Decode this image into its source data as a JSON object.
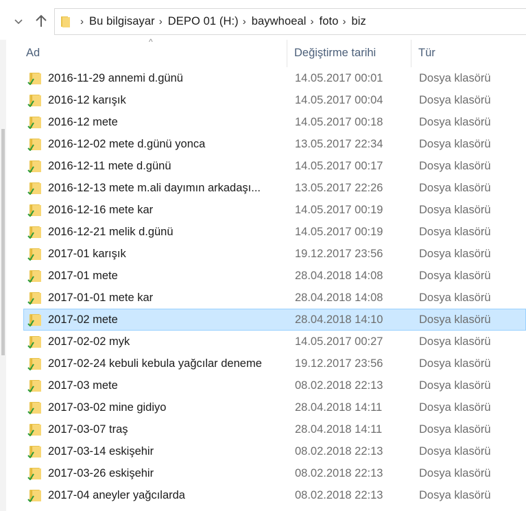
{
  "address": {
    "breadcrumbs": [
      "Bu bilgisayar",
      "DEPO 01 (H:)",
      "baywhoeal",
      "foto",
      "biz"
    ]
  },
  "icons": {
    "recent": "chevron-down-icon",
    "up": "up-arrow-icon",
    "folder": "folder-icon",
    "sync": "green-check-icon"
  },
  "columns": {
    "name": "Ad",
    "date": "Değiştirme tarihi",
    "type": "Tür"
  },
  "rows": [
    {
      "name": "2016-11-29 annemi d.günü",
      "date": "14.05.2017 00:01",
      "type": "Dosya klasörü"
    },
    {
      "name": "2016-12 karışık",
      "date": "14.05.2017 00:04",
      "type": "Dosya klasörü"
    },
    {
      "name": "2016-12 mete",
      "date": "14.05.2017 00:18",
      "type": "Dosya klasörü"
    },
    {
      "name": "2016-12-02 mete d.günü yonca",
      "date": "13.05.2017 22:34",
      "type": "Dosya klasörü"
    },
    {
      "name": "2016-12-11 mete d.günü",
      "date": "14.05.2017 00:17",
      "type": "Dosya klasörü"
    },
    {
      "name": "2016-12-13 mete m.ali dayımın arkadaşı...",
      "date": "13.05.2017 22:26",
      "type": "Dosya klasörü"
    },
    {
      "name": "2016-12-16 mete kar",
      "date": "14.05.2017 00:19",
      "type": "Dosya klasörü"
    },
    {
      "name": "2016-12-21 melik d.günü",
      "date": "14.05.2017 00:19",
      "type": "Dosya klasörü"
    },
    {
      "name": "2017-01 karışık",
      "date": "19.12.2017 23:56",
      "type": "Dosya klasörü"
    },
    {
      "name": "2017-01 mete",
      "date": "28.04.2018 14:08",
      "type": "Dosya klasörü"
    },
    {
      "name": "2017-01-01 mete kar",
      "date": "28.04.2018 14:08",
      "type": "Dosya klasörü"
    },
    {
      "name": "2017-02 mete",
      "date": "28.04.2018 14:10",
      "type": "Dosya klasörü",
      "selected": true
    },
    {
      "name": "2017-02-02 myk",
      "date": "14.05.2017 00:27",
      "type": "Dosya klasörü"
    },
    {
      "name": "2017-02-24 kebuli kebula yağcılar deneme",
      "date": "19.12.2017 23:56",
      "type": "Dosya klasörü"
    },
    {
      "name": "2017-03 mete",
      "date": "08.02.2018 22:13",
      "type": "Dosya klasörü"
    },
    {
      "name": "2017-03-02 mine gidiyo",
      "date": "28.04.2018 14:11",
      "type": "Dosya klasörü"
    },
    {
      "name": "2017-03-07 traş",
      "date": "28.04.2018 14:11",
      "type": "Dosya klasörü"
    },
    {
      "name": "2017-03-14 eskişehir",
      "date": "08.02.2018 22:13",
      "type": "Dosya klasörü"
    },
    {
      "name": "2017-03-26 eskişehir",
      "date": "08.02.2018 22:13",
      "type": "Dosya klasörü"
    },
    {
      "name": "2017-04 aneyler yağcılarda",
      "date": "08.02.2018 22:13",
      "type": "Dosya klasörü"
    }
  ]
}
